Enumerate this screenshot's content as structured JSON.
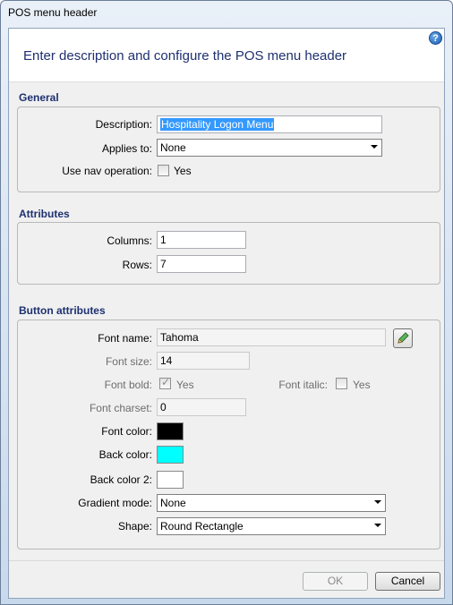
{
  "window": {
    "title": "POS menu header"
  },
  "header": {
    "title": "Enter description and configure the POS menu header",
    "help_icon": "?"
  },
  "general": {
    "section_title": "General",
    "description_label": "Description:",
    "description_value": "Hospitality Logon Menu",
    "applies_to_label": "Applies to:",
    "applies_to_value": "None",
    "use_nav_label": "Use nav operation:",
    "use_nav_checkbox_label": "Yes",
    "use_nav_checked": false
  },
  "attributes": {
    "section_title": "Attributes",
    "columns_label": "Columns:",
    "columns_value": "1",
    "rows_label": "Rows:",
    "rows_value": "7"
  },
  "button_attributes": {
    "section_title": "Button attributes",
    "font_name_label": "Font name:",
    "font_name_value": "Tahoma",
    "edit_font_icon": "pencil-icon",
    "font_size_label": "Font size:",
    "font_size_value": "14",
    "font_bold_label": "Font bold:",
    "font_bold_checkbox_label": "Yes",
    "font_bold_checked": true,
    "font_italic_label": "Font italic:",
    "font_italic_checkbox_label": "Yes",
    "font_italic_checked": false,
    "font_charset_label": "Font charset:",
    "font_charset_value": "0",
    "font_color_label": "Font color:",
    "font_color": "#000000",
    "back_color_label": "Back color:",
    "back_color": "#00ffff",
    "back_color2_label": "Back color 2:",
    "back_color2": "#ffffff",
    "gradient_mode_label": "Gradient mode:",
    "gradient_mode_value": "None",
    "shape_label": "Shape:",
    "shape_value": "Round Rectangle"
  },
  "footer": {
    "ok_label": "OK",
    "cancel_label": "Cancel"
  }
}
